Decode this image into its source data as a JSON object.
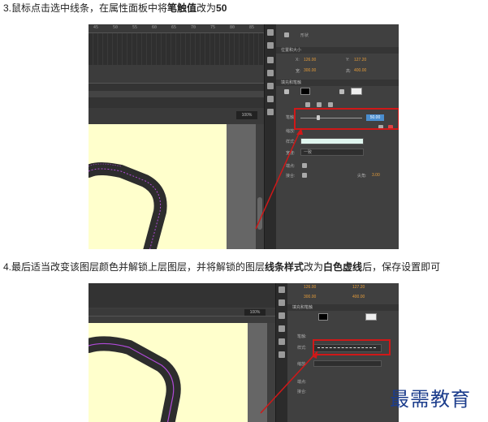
{
  "step3": {
    "prefix": "3.鼠标点击选中线条，在属性面板中将",
    "bold1": "笔触值",
    "mid": "改为",
    "bold2": "50"
  },
  "step4": {
    "prefix": "4.最后适当改变该图层颜色并解锁上层图层，并将解锁的图层",
    "bold1": "线条样式",
    "mid": "改为",
    "bold2": "白色虚线",
    "suffix": "后，保存设置即可"
  },
  "shot1": {
    "ruler_marks": [
      "45",
      "50",
      "55",
      "60",
      "65",
      "70",
      "75",
      "80",
      "85"
    ],
    "zoom": "100%",
    "panel": {
      "shape_label": "形状",
      "pos_section": "位置和大小",
      "x_label": "X:",
      "x_value": "126.00",
      "y_label": "Y:",
      "y_value": "127.20",
      "w_label": "宽:",
      "w_value": "300.00",
      "h_label": "高:",
      "h_value": "400.00",
      "fill_section": "填充和笔触",
      "stroke_label": "笔触:",
      "stroke_value": "50.00",
      "style_label": "样式:",
      "style_value": "实线",
      "width_label": "宽度:",
      "width_value": "一致",
      "scale_label": "缩放:",
      "scale_value": "一般",
      "cap_label": "端点:",
      "join_label": "接合:",
      "tip_label": "尖角:",
      "tip_value": "3.00"
    }
  },
  "shot2": {
    "panel": {
      "x_value": "126.00",
      "y_value": "127.20",
      "w_value": "300.00",
      "h_value": "400.00",
      "fill_section": "填充和笔触",
      "stroke_label": "笔触:",
      "style_label": "样式:",
      "scale_label": "缩放:",
      "cap_label": "端点:",
      "join_label": "接合:"
    },
    "zoom": "100%"
  },
  "watermark": "最需教育",
  "colors": {
    "stage": "#ffffcc",
    "highlight_box": "#d01818",
    "stroke_line": "#333333",
    "stroke_guide": "#b04ad8"
  }
}
